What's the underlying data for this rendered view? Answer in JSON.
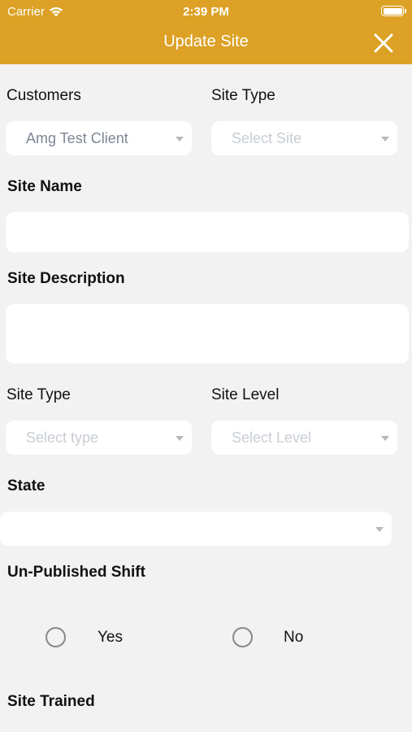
{
  "status_bar": {
    "carrier": "Carrier",
    "time": "2:39 PM"
  },
  "header": {
    "title": "Update Site"
  },
  "form": {
    "customers_label": "Customers",
    "customers_value": "Amg Test Client",
    "site_type_top_label": "Site Type",
    "site_type_top_placeholder": "Select Site",
    "site_name_label": "Site Name",
    "site_name_value": "",
    "site_description_label": "Site Description",
    "site_description_value": "",
    "site_type_label": "Site Type",
    "site_type_placeholder": "Select type",
    "site_level_label": "Site Level",
    "site_level_placeholder": "Select Level",
    "state_label": "State",
    "state_value": "",
    "unpublished_shift_label": "Un-Published Shift",
    "unpublished_options": [
      "Yes",
      "No"
    ],
    "site_trained_label": "Site Trained"
  },
  "colors": {
    "header": "#dca125",
    "background": "#f2f2f2"
  }
}
